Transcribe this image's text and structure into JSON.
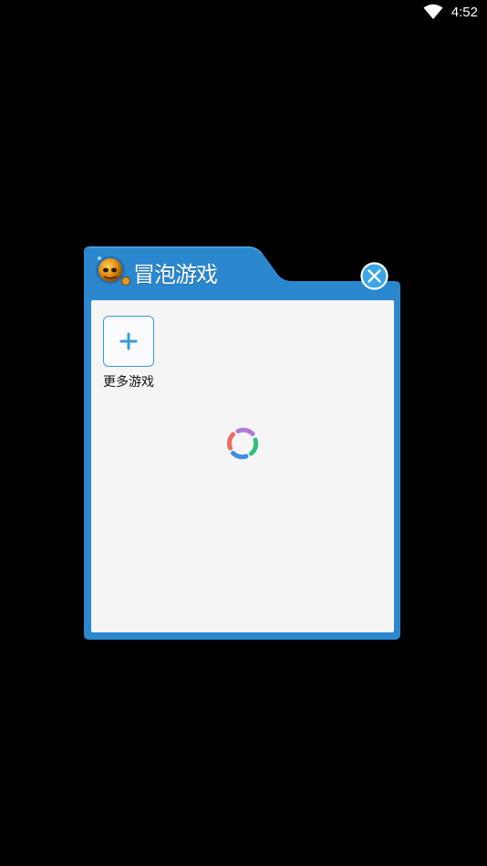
{
  "status_bar": {
    "time": "4:52",
    "wifi_icon": "wifi-icon"
  },
  "dialog": {
    "title": "冒泡游戏",
    "logo_icon": "bubble-mascot-logo-icon",
    "close_icon": "close-circle-icon",
    "more_games": {
      "label": "更多游戏",
      "icon": "plus-icon"
    },
    "loading_icon": "loading-spinner-icon"
  },
  "colors": {
    "frame_blue": "#2b88cf",
    "content_bg": "#f5f5f5",
    "accent_blue": "#3a9ad9",
    "spinner": [
      "#b07ad6",
      "#2ec07a",
      "#3e8fdb",
      "#ee6c5f"
    ]
  }
}
